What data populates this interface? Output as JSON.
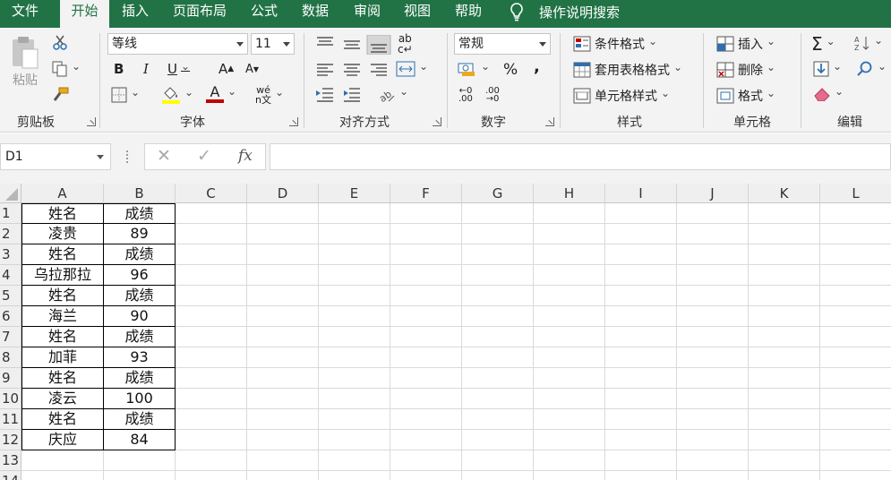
{
  "menu": {
    "tabs": [
      "文件",
      "开始",
      "插入",
      "页面布局",
      "公式",
      "数据",
      "审阅",
      "视图",
      "帮助"
    ],
    "active": "开始",
    "tell_me": "操作说明搜索"
  },
  "ribbon": {
    "clipboard": {
      "paste": "粘贴",
      "label": "剪贴板"
    },
    "font": {
      "name": "等线",
      "size": "11",
      "label": "字体",
      "bold": "B",
      "italic": "I",
      "underline": "U",
      "grow": "A",
      "shrink": "A",
      "font_color": "A",
      "phonetic": "wén文"
    },
    "alignment": {
      "label": "对齐方式"
    },
    "number": {
      "format": "常规",
      "label": "数字",
      "percent": "%",
      "comma": ","
    },
    "styles": {
      "conditional": "条件格式",
      "table": "套用表格格式",
      "cell": "单元格样式",
      "label": "样式"
    },
    "cells": {
      "insert": "插入",
      "delete": "删除",
      "format": "格式",
      "label": "单元格"
    },
    "editing": {
      "sum": "Σ",
      "label": "编辑"
    }
  },
  "formula_bar": {
    "name_box": "D1",
    "formula": "",
    "fx": "fx"
  },
  "sheet": {
    "columns": [
      "A",
      "B",
      "C",
      "D",
      "E",
      "F",
      "G",
      "H",
      "I",
      "J",
      "K",
      "L"
    ],
    "rows": [
      "1",
      "2",
      "3",
      "4",
      "5",
      "6",
      "7",
      "8",
      "9",
      "10",
      "11",
      "12",
      "13",
      "14"
    ],
    "data": [
      [
        "姓名",
        "成绩"
      ],
      [
        "凌贵",
        "89"
      ],
      [
        "姓名",
        "成绩"
      ],
      [
        "乌拉那拉",
        "96"
      ],
      [
        "姓名",
        "成绩"
      ],
      [
        "海兰",
        "90"
      ],
      [
        "姓名",
        "成绩"
      ],
      [
        "加菲",
        "93"
      ],
      [
        "姓名",
        "成绩"
      ],
      [
        "凌云",
        "100"
      ],
      [
        "姓名",
        "成绩"
      ],
      [
        "庆应",
        "84"
      ]
    ]
  },
  "colors": {
    "accent": "#217346",
    "ribbon": "#f3f3f3",
    "highlight_yellow": "#ffff00",
    "font_red": "#c00000"
  }
}
